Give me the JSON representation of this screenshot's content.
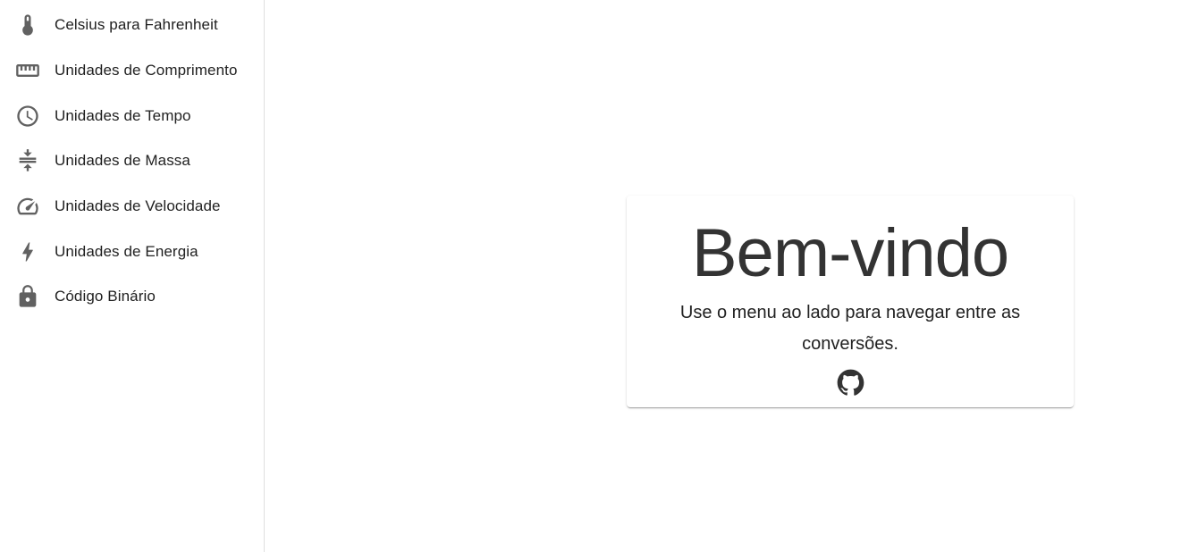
{
  "sidebar": {
    "items": [
      {
        "label": "Celsius para Fahrenheit",
        "icon": "thermometer-icon"
      },
      {
        "label": "Unidades de Comprimento",
        "icon": "ruler-icon"
      },
      {
        "label": "Unidades de Tempo",
        "icon": "clock-icon"
      },
      {
        "label": "Unidades de Massa",
        "icon": "compress-icon"
      },
      {
        "label": "Unidades de Velocidade",
        "icon": "speedometer-icon"
      },
      {
        "label": "Unidades de Energia",
        "icon": "lightning-bolt-icon"
      },
      {
        "label": "Código Binário",
        "icon": "lock-icon"
      }
    ]
  },
  "main": {
    "card": {
      "title": "Bem-vindo",
      "text": "Use o menu ao lado para navegar entre as conversões.",
      "link_icon": "github-icon"
    }
  },
  "colors": {
    "icon": "#616161",
    "text": "#212121",
    "title": "#333333",
    "divider": "#e0e0e0"
  }
}
